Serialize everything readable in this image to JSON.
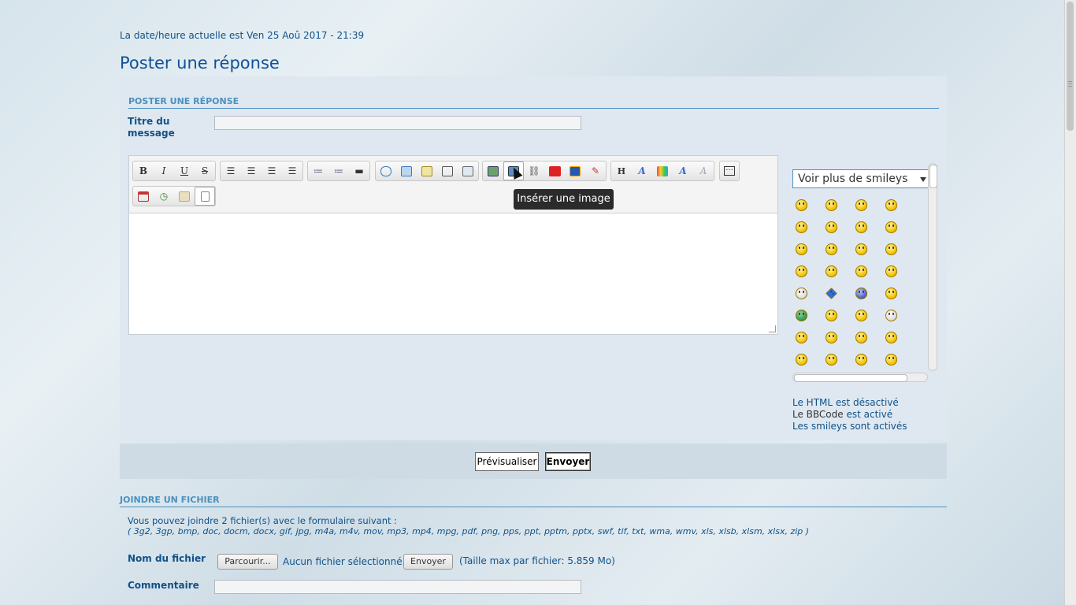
{
  "header": {
    "datetime": "La date/heure actuelle est Ven 25 Aoû 2017 - 21:39",
    "page_title": "Poster une réponse"
  },
  "post_form": {
    "section_title": "Poster une réponse",
    "subject_label_line1": "Titre du",
    "subject_label_line2": "message",
    "subject_value": ""
  },
  "toolbar": {
    "row1": [
      [
        "bold",
        "B"
      ],
      [
        "italic",
        "I"
      ],
      [
        "underline",
        "U"
      ],
      [
        "strikethrough",
        "S"
      ],
      [
        "align-left",
        ""
      ],
      [
        "align-center",
        ""
      ],
      [
        "align-right",
        ""
      ],
      [
        "justify",
        ""
      ],
      [
        "bullet-list",
        ""
      ],
      [
        "numbered-list",
        ""
      ],
      [
        "horizontal-rule",
        ""
      ],
      [
        "quote",
        ""
      ],
      [
        "code",
        ""
      ],
      [
        "spoiler",
        ""
      ],
      [
        "hide",
        ""
      ],
      [
        "table",
        ""
      ],
      [
        "insert-host-image",
        ""
      ],
      [
        "insert-image",
        ""
      ],
      [
        "insert-link",
        ""
      ],
      [
        "youtube",
        ""
      ],
      [
        "flash",
        ""
      ],
      [
        "tools",
        ""
      ],
      [
        "heading",
        "H"
      ],
      [
        "font-size",
        ""
      ],
      [
        "color",
        ""
      ],
      [
        "font",
        "A"
      ],
      [
        "remove-format",
        ""
      ],
      [
        "more",
        ""
      ]
    ],
    "row2": [
      [
        "date",
        ""
      ],
      [
        "time",
        ""
      ],
      [
        "paste",
        ""
      ],
      [
        "source",
        ""
      ]
    ],
    "tooltip": "Insérer une image"
  },
  "smileys": {
    "select_value": "Voir plus de smileys",
    "grid_rows": 8,
    "grid_cols": 4
  },
  "status": {
    "html": "Le HTML est désactivé",
    "bbcode_prefix": "Le BBCode",
    "bbcode_suffix": "est activé",
    "smileys": "Les smileys sont activés"
  },
  "actions": {
    "preview": "Prévisualiser",
    "send": "Envoyer"
  },
  "attachment": {
    "section_title": "Joindre un fichier",
    "info": "Vous pouvez joindre 2 fichier(s) avec le formulaire suivant :",
    "extensions": "( 3g2, 3gp, bmp, doc, docm, docx, gif, jpg, m4a, m4v, mov, mp3, mp4, mpg, pdf, png, pps, ppt, pptm, pptx, swf, tif, txt, wma, wmv, xls, xlsb, xlsm, xlsx, zip )",
    "file_label": "Nom du fichier",
    "browse": "Parcourir...",
    "no_file": "Aucun fichier sélectionné.",
    "upload": "Envoyer",
    "max_size": "(Taille max par fichier: 5.859 Mo)",
    "comment_label": "Commentaire",
    "comment_value": ""
  }
}
